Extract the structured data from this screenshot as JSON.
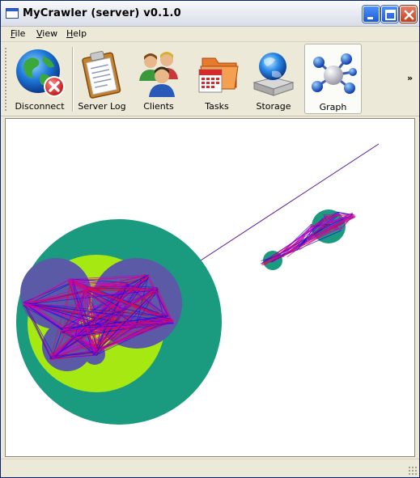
{
  "window": {
    "title": "MyCrawler (server) v0.1.0"
  },
  "title_buttons": {
    "minimize": "minimize-icon",
    "maximize": "maximize-icon",
    "close": "close-icon"
  },
  "menu": {
    "items": [
      {
        "label": "File",
        "accel": "F",
        "rest": "ile"
      },
      {
        "label": "View",
        "accel": "V",
        "rest": "iew"
      },
      {
        "label": "Help",
        "accel": "H",
        "rest": "elp"
      }
    ]
  },
  "toolbar": {
    "items": [
      {
        "label": "Disconnect",
        "icon": "globe-disconnect-icon",
        "active": false
      },
      {
        "label": "Server Log",
        "icon": "clipboard-icon",
        "active": false
      },
      {
        "label": "Clients",
        "icon": "users-icon",
        "active": false
      },
      {
        "label": "Tasks",
        "icon": "calendar-folder-icon",
        "active": false
      },
      {
        "label": "Storage",
        "icon": "globe-storage-icon",
        "active": false
      },
      {
        "label": "Graph",
        "icon": "molecule-graph-icon",
        "active": true
      }
    ],
    "overflow": "»"
  },
  "graph": {
    "colors": {
      "outer_cluster": "#1a9a7e",
      "inner_cluster": "#a6e812",
      "node_group": "#5a5aa6",
      "edge_blue": "#1414dc",
      "edge_red": "#d8103c",
      "edge_magenta": "#c800c8",
      "link": "#5a1496"
    }
  }
}
